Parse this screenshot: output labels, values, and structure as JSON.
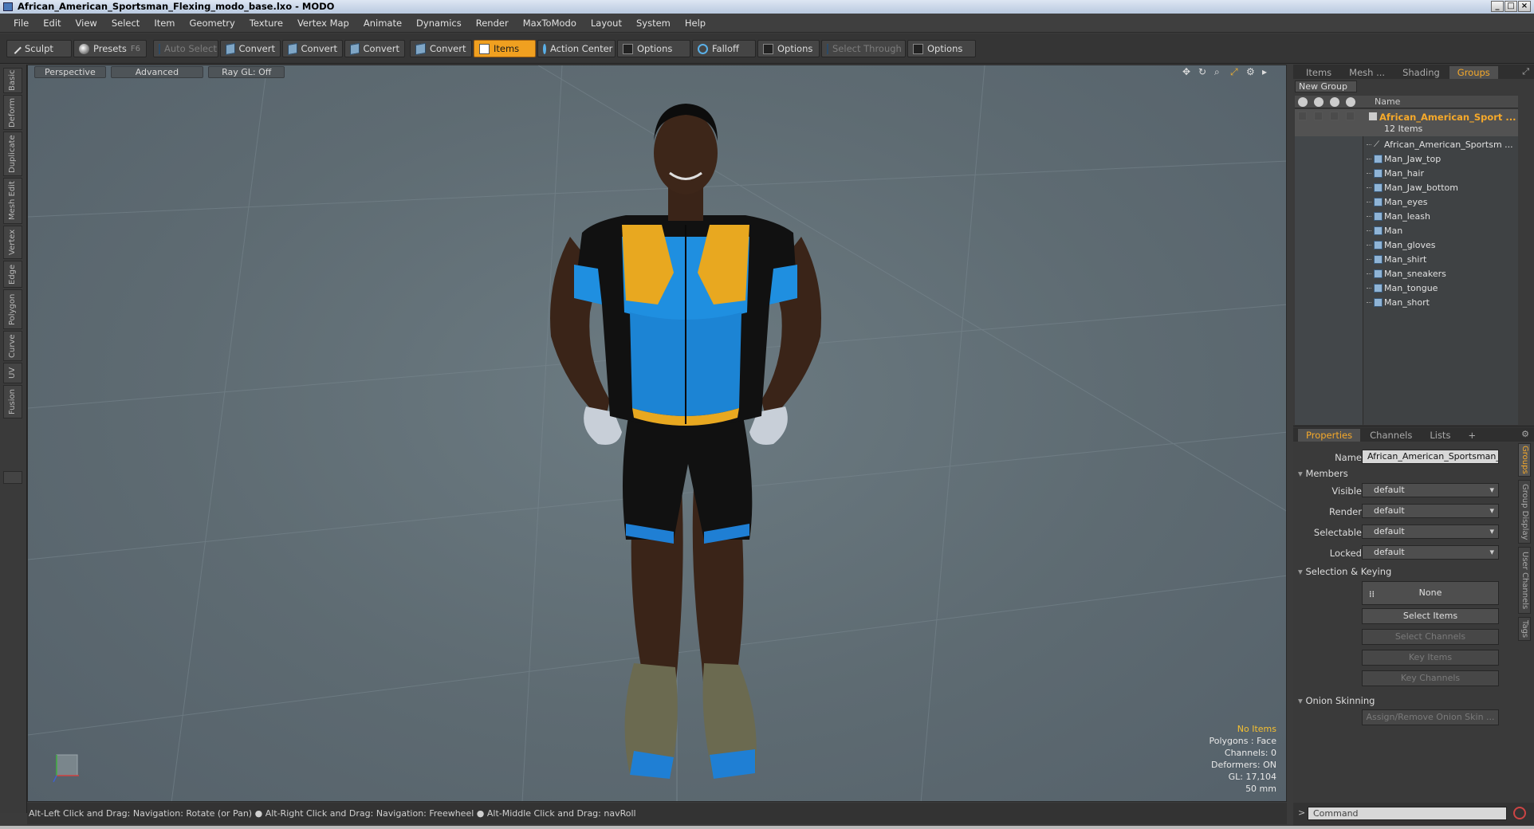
{
  "window": {
    "title": "African_American_Sportsman_Flexing_modo_base.lxo - MODO",
    "controls": [
      "_",
      "□",
      "×"
    ]
  },
  "menu": [
    "File",
    "Edit",
    "View",
    "Select",
    "Item",
    "Geometry",
    "Texture",
    "Vertex Map",
    "Animate",
    "Dynamics",
    "Render",
    "MaxToModo",
    "Layout",
    "System",
    "Help"
  ],
  "toolbar": {
    "sculpt": "Sculpt",
    "presets": "Presets",
    "presets_key": "F6",
    "auto_select": "Auto Select",
    "convert1": "Convert",
    "convert2": "Convert",
    "convert3": "Convert",
    "convert4": "Convert",
    "items": "Items",
    "action_center": "Action Center",
    "options1": "Options",
    "falloff": "Falloff",
    "options2": "Options",
    "select_through": "Select Through",
    "options3": "Options"
  },
  "left_tabs": [
    "Basic",
    "Deform",
    "Duplicate",
    "Mesh Edit",
    "Vertex",
    "Edge",
    "Polygon",
    "Curve",
    "UV",
    "Fusion"
  ],
  "viewport": {
    "view": "Perspective",
    "shading": "Advanced",
    "raygl": "Ray GL: Off",
    "stats": {
      "selection": "No Items",
      "polygons": "Polygons : Face",
      "channels": "Channels: 0",
      "deformers": "Deformers: ON",
      "gl": "GL: 17,104",
      "focal": "50 mm"
    }
  },
  "status": "Alt-Left Click and Drag: Navigation: Rotate (or Pan) ● Alt-Right Click and Drag: Navigation: Freewheel ● Alt-Middle Click and Drag: navRoll",
  "groups_panel": {
    "tabs": [
      "Items",
      "Mesh ...",
      "Shading",
      "Groups"
    ],
    "active_tab": "Groups",
    "new_group": "New Group",
    "col_name": "Name",
    "root": {
      "name": "African_American_Sport ...",
      "count": "12 Items"
    },
    "items": [
      "African_American_Sportsm ...",
      "Man_Jaw_top",
      "Man_hair",
      "Man_Jaw_bottom",
      "Man_eyes",
      "Man_leash",
      "Man",
      "Man_gloves",
      "Man_shirt",
      "Man_sneakers",
      "Man_tongue",
      "Man_short"
    ]
  },
  "properties": {
    "tabs": [
      "Properties",
      "Channels",
      "Lists",
      "+"
    ],
    "name_label": "Name",
    "name_value": "African_American_Sportsman_Fl",
    "members": "Members",
    "visible_label": "Visible",
    "visible": "default",
    "render_label": "Render",
    "render": "default",
    "selectable_label": "Selectable",
    "selectable": "default",
    "locked_label": "Locked",
    "locked": "default",
    "sel_keying": "Selection & Keying",
    "none": "None",
    "select_items": "Select Items",
    "select_channels": "Select Channels",
    "key_items": "Key Items",
    "key_channels": "Key Channels",
    "onion": "Onion Skinning",
    "assign_onion": "Assign/Remove Onion Skin ...",
    "side_tabs": [
      "Groups",
      "Group Display",
      "User Channels",
      "Tags"
    ]
  },
  "command": {
    "placeholder": "Command",
    "prompt": ">"
  },
  "colors": {
    "accent": "#f6a92a",
    "viewport_bg": "#5e6b72",
    "shirt_blue": "#1f8fe0",
    "shirt_yellow": "#e8a820"
  }
}
